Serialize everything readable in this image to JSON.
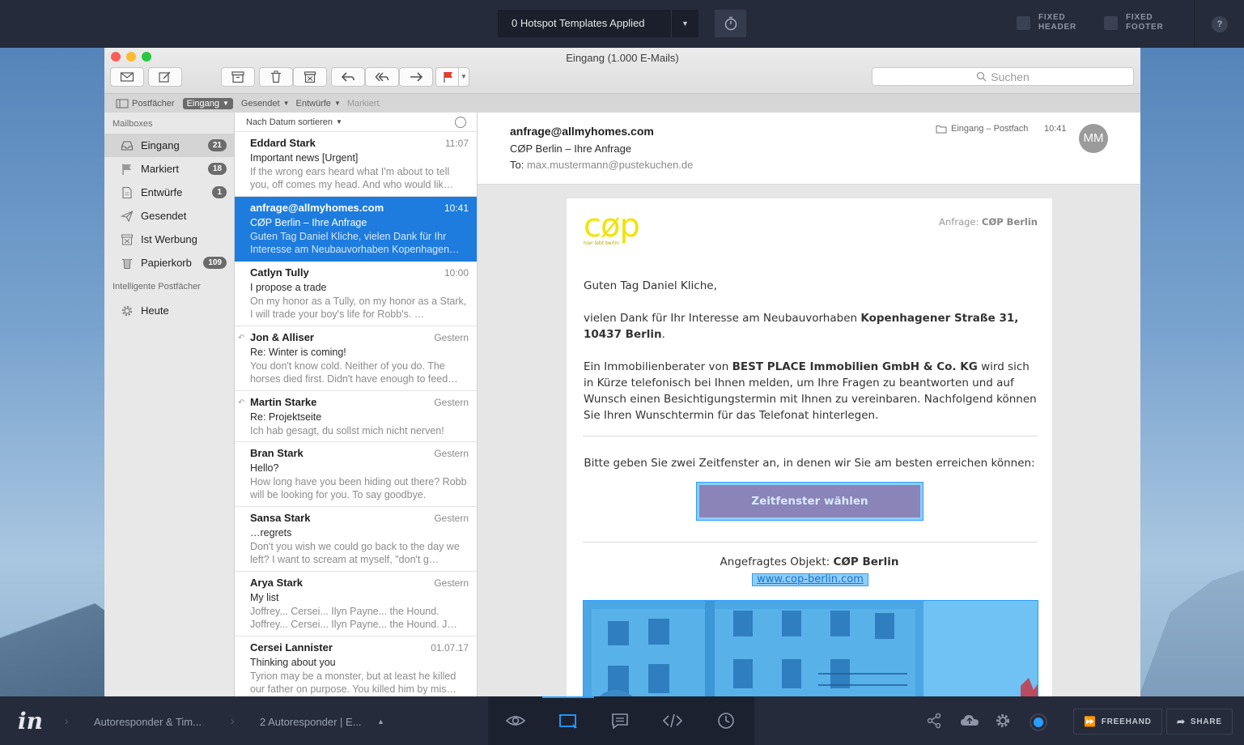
{
  "topbar": {
    "hotspot_label": "0 Hotspot Templates Applied",
    "fixed_header": [
      "FIXED",
      "HEADER"
    ],
    "fixed_footer": [
      "FIXED",
      "FOOTER"
    ],
    "help": "?"
  },
  "window": {
    "title": "Eingang (1.000 E-Mails)",
    "search_placeholder": "Suchen",
    "favorites": {
      "mailboxes": "Postfächer",
      "inbox": "Eingang",
      "sent": "Gesendet",
      "drafts": "Entwürfe",
      "flagged": "Markiert"
    }
  },
  "sidebar": {
    "heading": "Mailboxes",
    "items": [
      {
        "label": "Eingang",
        "count": "21",
        "icon": "inbox-icon"
      },
      {
        "label": "Markiert",
        "count": "18",
        "icon": "flag-icon"
      },
      {
        "label": "Entwürfe",
        "count": "1",
        "icon": "document-icon"
      },
      {
        "label": "Gesendet",
        "count": "",
        "icon": "paper-plane-icon"
      },
      {
        "label": "Ist Werbung",
        "count": "",
        "icon": "junk-icon"
      },
      {
        "label": "Papierkorb",
        "count": "109",
        "icon": "trash-icon"
      }
    ],
    "smart_heading": "Intelligente Postfächer",
    "smart_items": [
      {
        "label": "Heute",
        "icon": "gear-icon"
      }
    ]
  },
  "list": {
    "sort_label": "Nach Datum sortieren",
    "messages": [
      {
        "from": "Eddard Stark",
        "time": "11:07",
        "subject": "Important news [Urgent]",
        "preview": "If the wrong ears heard what I'm about to tell you, off comes my head. And who would lik…"
      },
      {
        "from": "anfrage@allmyhomes.com",
        "time": "10:41",
        "subject": "CØP Berlin – Ihre Anfrage",
        "preview": "Guten Tag Daniel Kliche, vielen Dank für Ihr Interesse am Neubauvorhaben Kopenhagen…"
      },
      {
        "from": "Catlyn Tully",
        "time": "10:00",
        "subject": "I propose a trade",
        "preview": "On my honor as a Tully, on my honor as a Stark, I will trade your boy's life for Robb's. …"
      },
      {
        "from": "Jon & Alliser",
        "time": "Gestern",
        "subject": "Re: Winter is coming!",
        "preview": "You don't know cold. Neither of you do. The horses died first. Didn't have enough to feed…"
      },
      {
        "from": "Martin Starke",
        "time": "Gestern",
        "subject": "Re: Projektseite",
        "preview": "Ich hab gesagt, du sollst mich nicht nerven!"
      },
      {
        "from": "Bran Stark",
        "time": "Gestern",
        "subject": "Hello?",
        "preview": "How long have you been hiding out there? Robb will be looking for you. To say goodbye."
      },
      {
        "from": "Sansa Stark",
        "time": "Gestern",
        "subject": "…regrets",
        "preview": "Don't you wish we could go back to the day we left? I want to scream at myself, \"don't g…"
      },
      {
        "from": "Arya Stark",
        "time": "Gestern",
        "subject": "My list",
        "preview": "Joffrey... Cersei... Ilyn Payne... the Hound. Joffrey... Cersei... Ilyn Payne... the Hound. J…"
      },
      {
        "from": "Cersei Lannister",
        "time": "01.07.17",
        "subject": "Thinking about you",
        "preview": "Tyrion may be a monster, but at least he killed our father on purpose. You killed him by mis…"
      }
    ]
  },
  "reader": {
    "from": "anfrage@allmyhomes.com",
    "subject": "CØP Berlin – Ihre Anfrage",
    "to_label": "To:",
    "to_addr": "max.mustermann@pustekuchen.de",
    "folder": "Eingang – Postfach",
    "time": "10:41",
    "avatar": "MM",
    "body": {
      "logo": "cøp",
      "logo_tagline": "hier lebt berlin",
      "anfrage_label": "Anfrage:",
      "anfrage_value": "CØP Berlin",
      "greeting": "Guten Tag Daniel Kliche,",
      "p1_a": "vielen Dank für Ihr Interesse am Neubauvorhaben ",
      "p1_b": "Kopenhagener Straße 31, 10437 Berlin",
      "p1_c": ".",
      "p2_a": "Ein Immobilienberater von ",
      "p2_b": "BEST PLACE Immobilien GmbH & Co. KG",
      "p2_c": " wird sich in Kürze telefonisch bei Ihnen melden, um Ihre Fragen zu beantworten und auf Wunsch einen Besichtigungstermin mit Ihnen zu vereinbaren. Nachfolgend können Sie Ihren Wunschtermin für das Telefonat hinterlegen.",
      "prompt": "Bitte geben Sie zwei Zeitfenster an, in denen wir Sie am besten erreichen können:",
      "cta": "Zeitfenster wählen",
      "object_label": "Angefragtes Objekt: ",
      "object_value": "CØP Berlin",
      "link": "www.cop-berlin.com"
    }
  },
  "bottombar": {
    "logo": "in",
    "crumb1": "Autoresponder & Tim...",
    "crumb2": "2 Autoresponder | E...",
    "freehand": "FREEHAND",
    "share": "SHARE"
  }
}
